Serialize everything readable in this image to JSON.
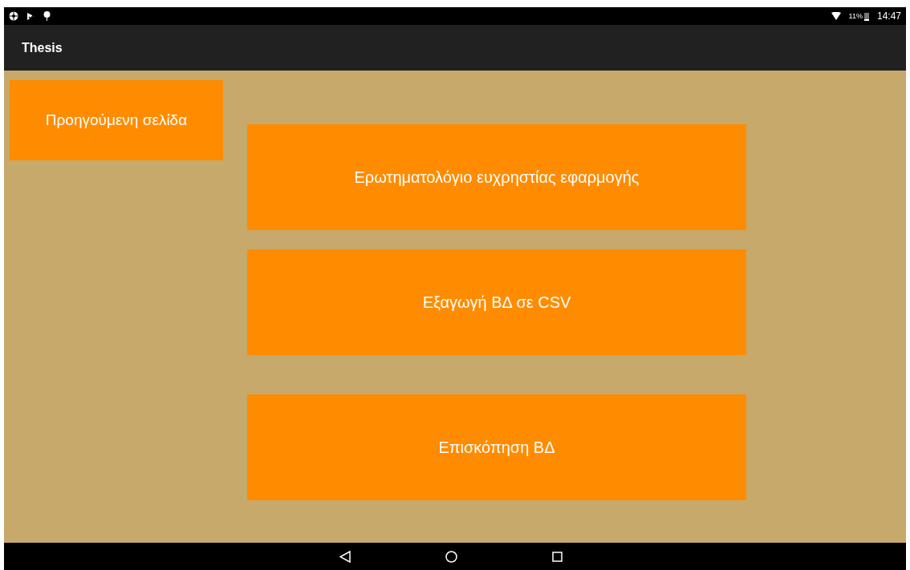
{
  "status_bar": {
    "battery": "11%",
    "time": "14:47"
  },
  "app_bar": {
    "title": "Thesis"
  },
  "back_button": {
    "label": "Προηγούμενη σελίδα"
  },
  "buttons": [
    {
      "label": "Ερωτηματολόγιο ευχρηστίας εφαρμογής"
    },
    {
      "label": "Εξαγωγή ΒΔ σε CSV"
    },
    {
      "label": "Επισκόπηση ΒΔ"
    }
  ]
}
